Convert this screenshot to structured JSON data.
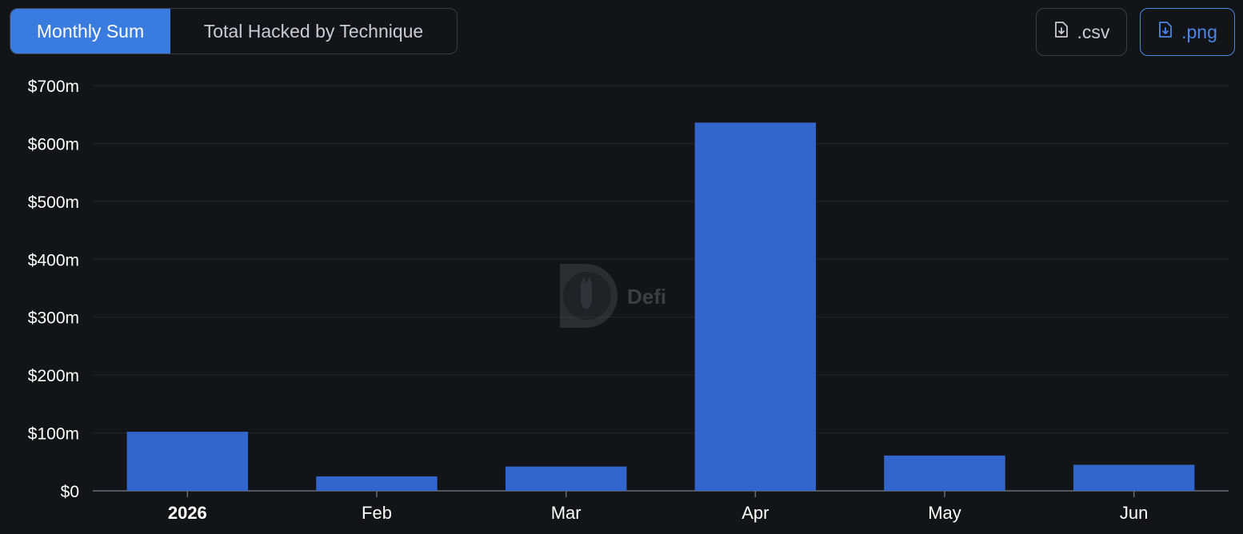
{
  "toolbar": {
    "tabs": [
      {
        "label": "Monthly Sum",
        "active": true
      },
      {
        "label": "Total Hacked by Technique",
        "active": false
      }
    ],
    "csv_label": ".csv",
    "png_label": ".png"
  },
  "watermark_text": "Defi",
  "colors": {
    "background": "#131417",
    "bar": "#3366cc",
    "active_tab": "#3a7be0",
    "png_accent": "#4a86e8"
  },
  "icons": {
    "csv": "file-download-icon",
    "png": "file-download-icon",
    "watermark": "llama-logo-icon"
  },
  "chart_data": {
    "type": "bar",
    "categories": [
      "2026",
      "Feb",
      "Mar",
      "Apr",
      "May",
      "Jun"
    ],
    "values": [
      102,
      25,
      42,
      636,
      61,
      45
    ],
    "unit": "$m",
    "ylim": [
      0,
      700
    ],
    "yticks": [
      "$0",
      "$100m",
      "$200m",
      "$300m",
      "$400m",
      "$500m",
      "$600m",
      "$700m"
    ],
    "grid": true,
    "legend": "none"
  }
}
